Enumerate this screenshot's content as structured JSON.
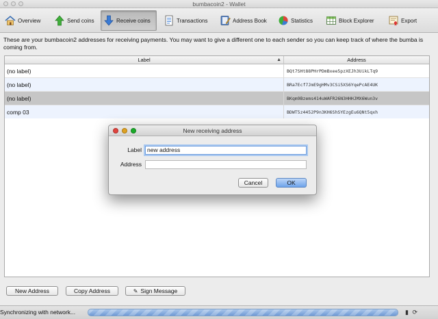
{
  "window": {
    "title": "bumbacoin2 - Wallet"
  },
  "toolbar": {
    "items": [
      {
        "label": "Overview"
      },
      {
        "label": "Send coins"
      },
      {
        "label": "Receive coins"
      },
      {
        "label": "Transactions"
      },
      {
        "label": "Address Book"
      },
      {
        "label": "Statistics"
      },
      {
        "label": "Block Explorer"
      },
      {
        "label": "Export"
      }
    ],
    "active": "Receive coins"
  },
  "main": {
    "description": "These are your bumbacoin2 addresses for receiving payments. You may want to give a different one to each sender so you can keep track of where the bumba is coming from.",
    "table": {
      "columns": [
        "Label",
        "Address"
      ],
      "rows": [
        {
          "label": "(no label)",
          "address": "BQt7SHt88PHrPDmBxee5pzXEJh3UikLTq9"
        },
        {
          "label": "(no label)",
          "address": "BRa7Ecf7JmE9gHMv3CSi5XS6YqePcAE4UK"
        },
        {
          "label": "(no label)",
          "address": "BKqm9Bzems414uWAFR26N3HHHJMX6Wun3v"
        },
        {
          "label": "comp 03",
          "address": "BDWT5z4452P9n3KH6ShSYEzgEu6QNt5qxh"
        }
      ]
    }
  },
  "buttons": {
    "new_address": "New Address",
    "copy_address": "Copy Address",
    "sign_message": "Sign Message"
  },
  "status": {
    "text": "Synchronizing with network..."
  },
  "dialog": {
    "title": "New receiving address",
    "label_field": {
      "label": "Label",
      "value": "new address"
    },
    "address_field": {
      "label": "Address",
      "value": ""
    },
    "cancel": "Cancel",
    "ok": "OK"
  },
  "colors": {
    "accent_blue": "#6ea3ea",
    "row_alt": "#edf3fe",
    "row_selected": "#c6c6c6",
    "close_red": "#e0443e",
    "minimize_yellow": "#dea123",
    "zoom_green": "#1aab29"
  }
}
